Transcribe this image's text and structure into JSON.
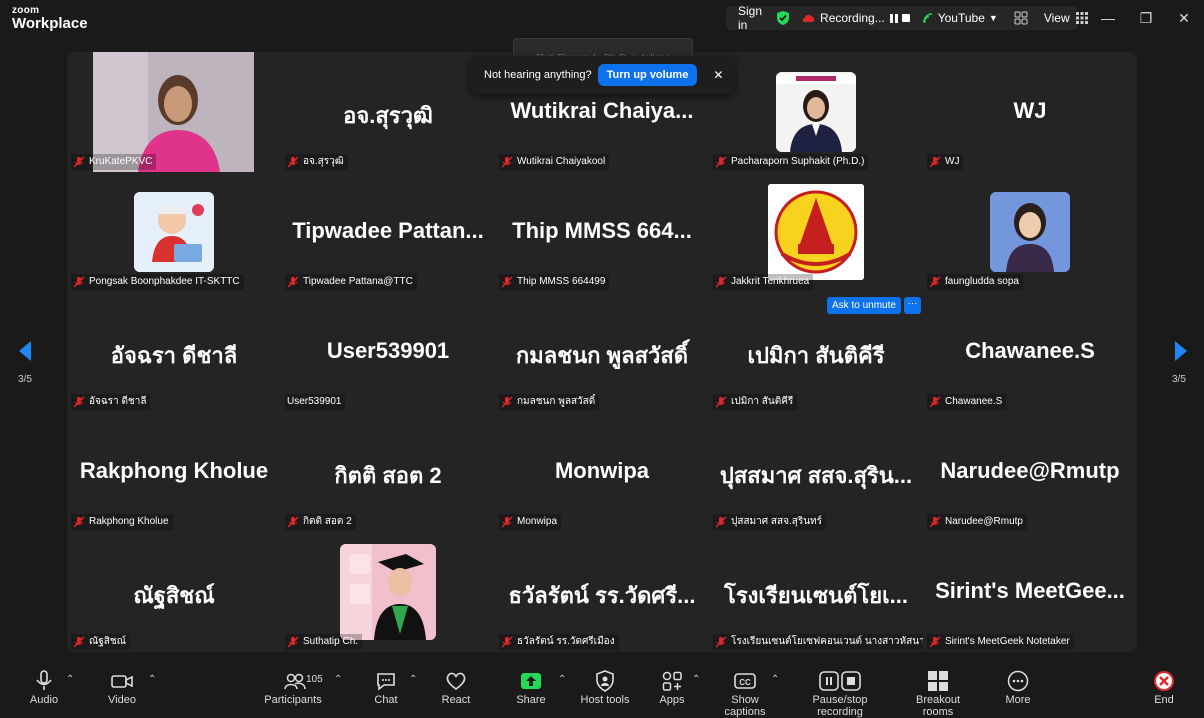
{
  "app": {
    "brand_top": "zoom",
    "brand_bottom": "Workplace"
  },
  "header": {
    "sign_in": "Sign in",
    "recording": "Recording...",
    "youtube": "YouTube",
    "view": "View"
  },
  "talking_banner": "Thiti Tharasuk, Ph.D. is talking",
  "toast": {
    "text": "Not hearing anything?",
    "button": "Turn up volume"
  },
  "ask_to_unmute": "Ask to unmute",
  "more_dots": "···",
  "page_indicator_left": "3/5",
  "page_indicator_right": "3/5",
  "participants_count": "105",
  "tiles": [
    {
      "big": "",
      "label": "KruKatePKVC",
      "muted": true,
      "photo": "woman-pink"
    },
    {
      "big": "อจ.สุรวุฒิ",
      "label": "อจ.สุรวุฒิ",
      "muted": true
    },
    {
      "big": "Wutikrai  Chaiya...",
      "label": "Wutikrai  Chaiyakool",
      "muted": true
    },
    {
      "big": "",
      "label": "Pacharaporn Suphakit (Ph.D.)",
      "muted": true,
      "photo": "woman-suit"
    },
    {
      "big": "WJ",
      "label": "WJ",
      "muted": true
    },
    {
      "big": "",
      "label": "Pongsak Boonphakdee IT-SKTTC",
      "muted": true,
      "photo": "avatar-3d"
    },
    {
      "big": "Tipwadee  Pattan...",
      "label": "Tipwadee Pattana@TTC",
      "muted": true
    },
    {
      "big": "Thip MMSS 664...",
      "label": "Thip MMSS 664499",
      "muted": true
    },
    {
      "big": "",
      "label": "Jakkrit Tenkhruea",
      "muted": true,
      "photo": "emblem"
    },
    {
      "big": "",
      "label": "faungludda sopa",
      "muted": true,
      "photo": "woman-glasses"
    },
    {
      "big": "อัจฉรา ดีชาลี",
      "label": "อัจฉรา ดีชาลี",
      "muted": true
    },
    {
      "big": "User539901",
      "label": "User539901",
      "muted": false
    },
    {
      "big": "กมลชนก  พูลสวัสดิ์",
      "label": "กมลชนก  พูลสวัสดิ์",
      "muted": true
    },
    {
      "big": "เปมิกา สันติคีรี",
      "label": "เปมิกา สันติคีรี",
      "muted": true
    },
    {
      "big": "Chawanee.S",
      "label": "Chawanee.S",
      "muted": true
    },
    {
      "big": "Rakphong Kholue",
      "label": "Rakphong Kholue",
      "muted": true
    },
    {
      "big": "กิตติ สอต 2",
      "label": "กิตติ สอต 2",
      "muted": true
    },
    {
      "big": "Monwipa",
      "label": "Monwipa",
      "muted": true
    },
    {
      "big": "ปุสสมาศ สสจ.สุริน...",
      "label": "ปุสสมาศ สสจ.สุรินทร์",
      "muted": true
    },
    {
      "big": "Narudee@Rmutp",
      "label": "Narudee@Rmutp",
      "muted": true
    },
    {
      "big": "ณัฐสิชณ์",
      "label": "ณัฐสิชณ์",
      "muted": true
    },
    {
      "big": "",
      "label": "Suthatip Ch.",
      "muted": true,
      "photo": "graduate"
    },
    {
      "big": "ธวัลรัตน์ รร.วัดศรี...",
      "label": "ธวัลรัตน์ รร.วัดศรีเมือง",
      "muted": true
    },
    {
      "big": "โรงเรียนเซนต์โยเ...",
      "label": "โรงเรียนเซนต์โยเซฟคอนเวนต์ นางสาวหัสนา อัสด...",
      "muted": true
    },
    {
      "big": "Sirint's  MeetGee...",
      "label": "Sirint's MeetGeek Notetaker",
      "muted": true
    }
  ],
  "toolbar": {
    "audio": "Audio",
    "video": "Video",
    "participants": "Participants",
    "chat": "Chat",
    "react": "React",
    "share": "Share",
    "host_tools": "Host tools",
    "apps": "Apps",
    "captions": "Show captions",
    "recording": "Pause/stop recording",
    "breakout": "Breakout rooms",
    "more": "More",
    "end": "End"
  },
  "colors": {
    "accent": "#0e72ed",
    "muted_red": "#e02828",
    "share_green": "#23d959",
    "end_red": "#e02828",
    "shield_green": "#23d959"
  }
}
